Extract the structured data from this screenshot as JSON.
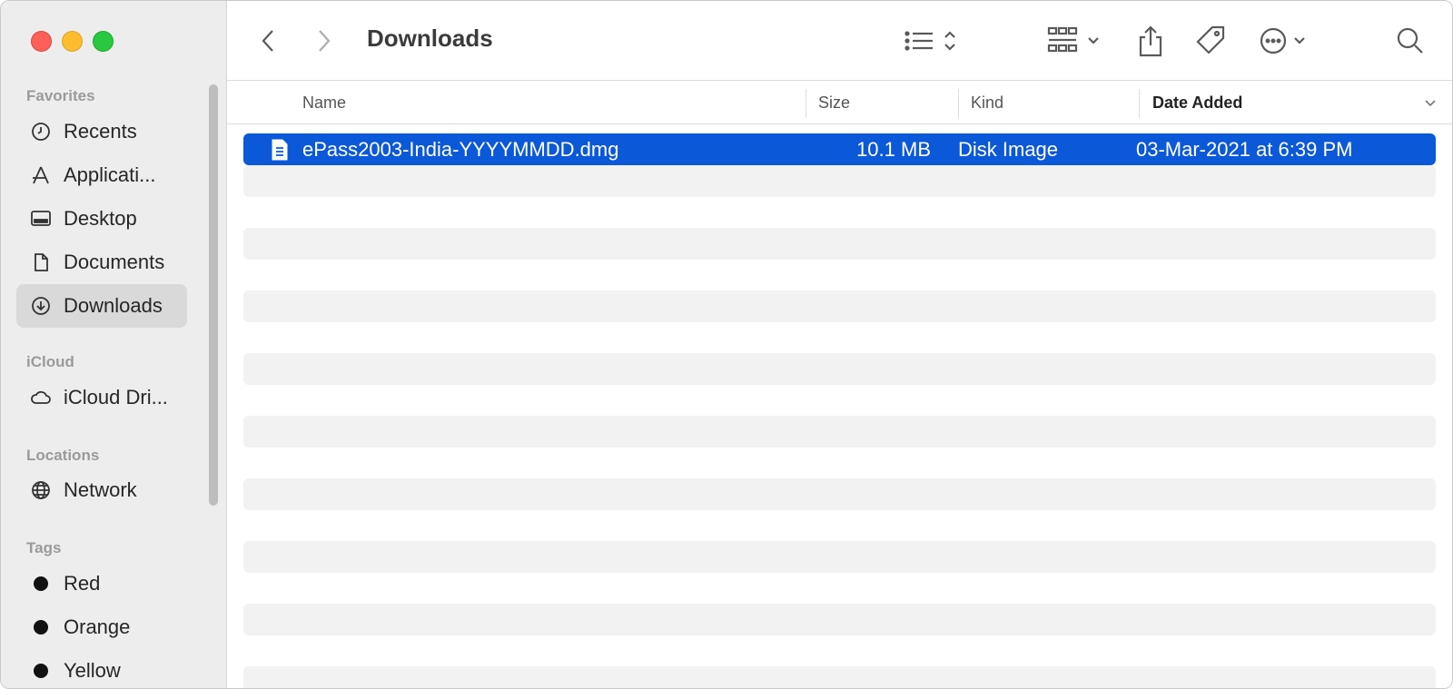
{
  "window": {
    "title": "Downloads"
  },
  "sidebar": {
    "sections": {
      "favorites": "Favorites",
      "icloud": "iCloud",
      "locations": "Locations",
      "tags": "Tags"
    },
    "favorites": [
      {
        "label": "Recents",
        "icon": "clock-icon"
      },
      {
        "label": "Applicati...",
        "icon": "applications-icon"
      },
      {
        "label": "Desktop",
        "icon": "desktop-icon"
      },
      {
        "label": "Documents",
        "icon": "document-icon"
      },
      {
        "label": "Downloads",
        "icon": "download-icon",
        "selected": true
      }
    ],
    "icloud": [
      {
        "label": "iCloud Dri...",
        "icon": "cloud-icon"
      }
    ],
    "locations": [
      {
        "label": "Network",
        "icon": "globe-icon"
      }
    ],
    "tags": [
      {
        "label": "Red"
      },
      {
        "label": "Orange"
      },
      {
        "label": "Yellow"
      }
    ]
  },
  "toolbar": {
    "back_icon": "chevron-left-icon",
    "forward_icon": "chevron-right-icon",
    "title": "Downloads",
    "view_icon": "list-view-icon",
    "group_icon": "group-grid-icon",
    "share_icon": "share-icon",
    "tag_icon": "tag-icon",
    "more_icon": "ellipsis-circle-icon",
    "search_icon": "search-icon"
  },
  "columns": {
    "name": "Name",
    "size": "Size",
    "kind": "Kind",
    "date_added": "Date Added"
  },
  "files": [
    {
      "name": "ePass2003-India-YYYYMMDD.dmg",
      "size": "10.1 MB",
      "kind": "Disk Image",
      "date_added": "03-Mar-2021 at 6:39 PM",
      "selected": true
    }
  ],
  "colors": {
    "selection": "#0b58d9",
    "sidebar_bg": "#ededed",
    "close": "#fe5f57",
    "minimize": "#febc2e",
    "maximize": "#28c840"
  }
}
